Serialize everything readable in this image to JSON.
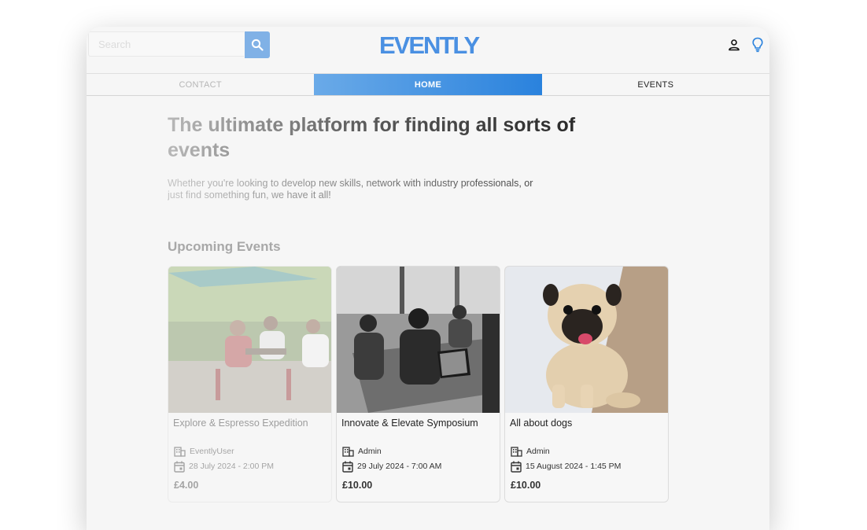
{
  "header": {
    "search_placeholder": "Search",
    "search_button_icon": "search-icon",
    "logo_text": "EVENTLY",
    "account_icon": "account-icon",
    "theme_icon": "lightbulb-icon",
    "brand_color": "#4a90e2"
  },
  "nav": {
    "tabs": [
      {
        "label": "CONTACT",
        "state": "default"
      },
      {
        "label": "HOME",
        "state": "active"
      },
      {
        "label": "EVENTS",
        "state": "default"
      }
    ]
  },
  "hero": {
    "title": "The ultimate platform for finding all sorts of events",
    "subtitle": "Whether you're looking to develop new skills, network with industry professionals, or just find something fun, we have it all!"
  },
  "upcoming": {
    "title": "Upcoming Events",
    "events": [
      {
        "title": "Explore & Espresso Expedition",
        "organizer": "EventlyUser",
        "datetime": "28 July 2024 - 2:00 PM",
        "price": "£4.00",
        "organizer_icon": "building-icon",
        "date_icon": "calendar-icon"
      },
      {
        "title": "Innovate & Elevate Symposium",
        "organizer": "Admin",
        "datetime": "29 July 2024 - 7:00 AM",
        "price": "£10.00",
        "organizer_icon": "building-icon",
        "date_icon": "calendar-icon"
      },
      {
        "title": "All about dogs",
        "organizer": "Admin",
        "datetime": "15 August 2024 - 1:45 PM",
        "price": "£10.00",
        "organizer_icon": "building-icon",
        "date_icon": "calendar-icon"
      }
    ]
  }
}
